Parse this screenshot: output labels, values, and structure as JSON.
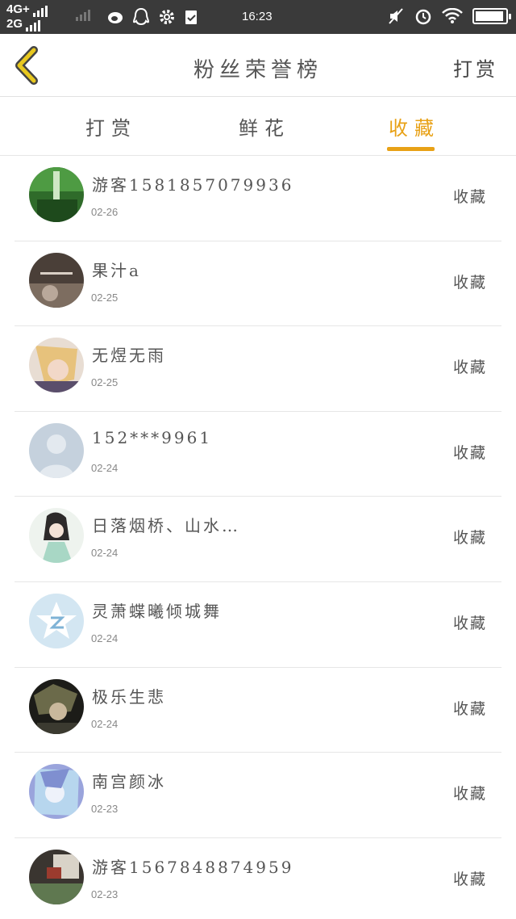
{
  "status_bar": {
    "net1": "4G+",
    "net2": "2G",
    "time": "16:23",
    "icons_left": [
      "weibo-icon",
      "qq-icon",
      "gear-icon",
      "clipboard-icon"
    ],
    "icons_right": [
      "mute-icon",
      "alarm-icon",
      "wifi-icon",
      "battery-icon"
    ],
    "battery_level": 0.95
  },
  "header": {
    "title": "粉丝荣誉榜",
    "action": "打赏",
    "accent": "#e8a116"
  },
  "tabs": [
    {
      "label": "打赏",
      "active": false
    },
    {
      "label": "鲜花",
      "active": false
    },
    {
      "label": "收藏",
      "active": true
    }
  ],
  "fans": [
    {
      "name": "游客1581857079936",
      "date": "02-26",
      "action": "收藏",
      "avatar": "forest-waterfall"
    },
    {
      "name": "果汁a",
      "date": "02-25",
      "action": "收藏",
      "avatar": "dark-photo"
    },
    {
      "name": "无煜无雨",
      "date": "02-25",
      "action": "收藏",
      "avatar": "anime-blonde"
    },
    {
      "name": "152***9961",
      "date": "02-24",
      "action": "收藏",
      "avatar": "default-person"
    },
    {
      "name": "日落烟桥、山水…",
      "date": "02-24",
      "action": "收藏",
      "avatar": "anime-green"
    },
    {
      "name": "灵萧蝶曦倾城舞",
      "date": "02-24",
      "action": "收藏",
      "avatar": "qq-star"
    },
    {
      "name": "极乐生悲",
      "date": "02-24",
      "action": "收藏",
      "avatar": "anime-dark"
    },
    {
      "name": "南宫颜冰",
      "date": "02-23",
      "action": "收藏",
      "avatar": "anime-blue"
    },
    {
      "name": "游客1567848874959",
      "date": "02-23",
      "action": "收藏",
      "avatar": "dark-room"
    }
  ]
}
